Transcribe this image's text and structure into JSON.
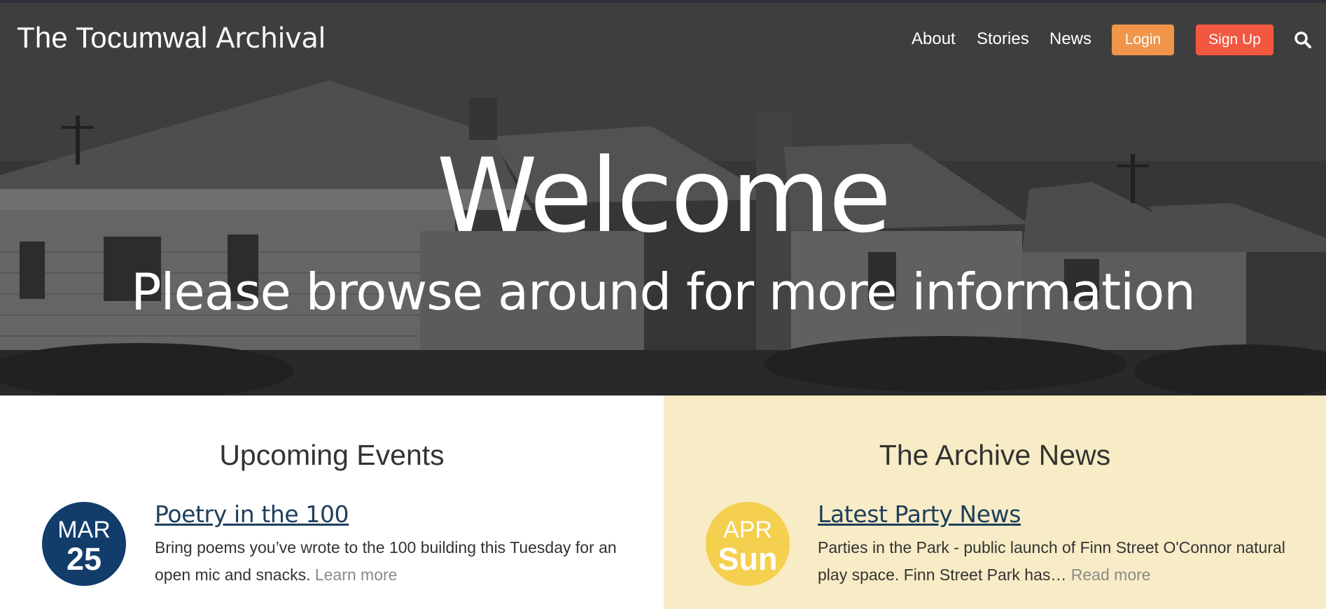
{
  "brand": {
    "part1": "The Tocumwal",
    "part2": "Archival"
  },
  "nav": {
    "about": "About",
    "stories": "Stories",
    "news": "News",
    "login": "Login",
    "signup": "Sign Up"
  },
  "icons": {
    "search": "search-icon"
  },
  "hero": {
    "title": "Welcome",
    "subtitle": "Please browse around for more information"
  },
  "events": {
    "heading": "Upcoming Events",
    "item": {
      "month": "MAR",
      "day": "25",
      "title": "Poetry in the 100",
      "text": "Bring poems you’ve wrote to the 100 building this Tuesday for an open mic and snacks.",
      "link": "Learn more"
    }
  },
  "news": {
    "heading": "The Archive News",
    "item": {
      "month": "APR",
      "day": "Sun",
      "title": "Latest Party News",
      "text": "Parties in the Park - public launch of Finn Street O'Connor natural play space. Finn Street Park has…",
      "link": "Read more"
    }
  },
  "colors": {
    "navy": "#123d6b",
    "yellow_badge": "#f5cf4e",
    "news_bg": "#f8ecc6",
    "login": "#f0954a",
    "signup": "#f2573f"
  }
}
